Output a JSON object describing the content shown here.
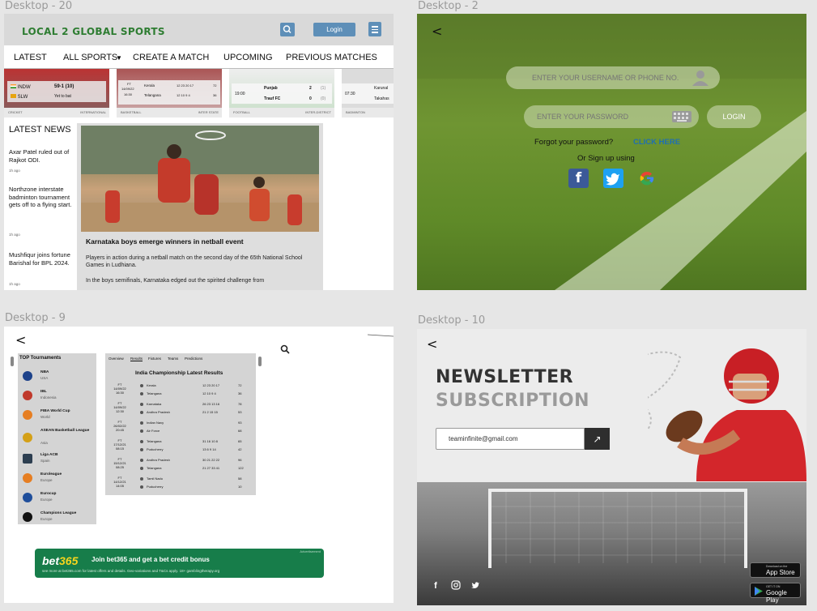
{
  "frames": {
    "desktop20": "Desktop - 20",
    "desktop2": "Desktop - 2",
    "desktop9": "Desktop - 9",
    "desktop10": "Desktop - 10"
  },
  "home": {
    "logo": "LOCAL 2 GLOBAL SPORTS",
    "login_label": "Login",
    "nav": [
      "LATEST",
      "ALL SPORTS",
      "CREATE A MATCH",
      "UPCOMING",
      "PREVIOUS MATCHES"
    ],
    "score_cards": [
      {
        "sport": "CRICKET",
        "level": "INTERNATIONAL",
        "team1": "INDW",
        "score1": "59-1 (10)",
        "team2": "SLW",
        "score2": "Yet to bat"
      },
      {
        "sport": "BASKETBALL",
        "level": "INTER STATE",
        "status": "FT",
        "date": "14/09/22",
        "time": "16:30",
        "team1": "Kerala",
        "q1": "12  23  20  17",
        "t1": "72",
        "team2": "Telangana",
        "q2": "12  10  9  4",
        "t2": "36"
      },
      {
        "sport": "FOOTBALL",
        "level": "INTER-DISTRICT",
        "time": "19:00",
        "team1": "Punjab",
        "score1": "2",
        "pen1": "(1)",
        "team2": "Trauf FC",
        "score2": "0",
        "pen2": "(0)"
      },
      {
        "sport": "BADMINTON",
        "time": "07:30",
        "team1": "Karunal",
        "team2": "Takahas"
      }
    ],
    "latest_news_heading": "LATEST NEWS",
    "news": [
      {
        "text": "Axar Patel ruled out of Rajkot ODI.",
        "ago": "1h ago"
      },
      {
        "text": "Northzone interstate badminton tournament gets off to a flying start.",
        "ago": "1h ago"
      },
      {
        "text": "Mushfiqur joins fortune Barishal for BPL 2024.",
        "ago": "1h ago"
      }
    ],
    "feature": {
      "title": "Karnataka boys emerge winners in netball event",
      "p1": "Players in action during a netball match on the second day of the 65th National School Games in Ludhiana.",
      "p2": "In the boys semifinals, Karnataka edged out the spirited challenge from"
    }
  },
  "login": {
    "back": "<",
    "username_placeholder": "ENTER YOUR USERNAME OR PHONE NO.",
    "password_placeholder": "ENTER YOUR PASSWORD",
    "login_label": "LOGIN",
    "forgot": "Forgot your password?",
    "click_here": "CLICK HERE",
    "or_signup": "Or Sign up using"
  },
  "tournaments": {
    "back": "<",
    "sidebar_heading": "TOP Tournaments",
    "items": [
      {
        "name": "NBA",
        "country": "USA",
        "color": "#1d428a"
      },
      {
        "name": "IBL",
        "country": "Indonesia",
        "color": "#c0392b"
      },
      {
        "name": "FIBA World Cup",
        "country": "World",
        "color": "#e67e22"
      },
      {
        "name": "ASEAN Basketball League",
        "country": "Asia",
        "color": "#d4a017"
      },
      {
        "name": "Liga ACB",
        "country": "Spain",
        "color": "#2c3e50"
      },
      {
        "name": "Euroleague",
        "country": "Europe",
        "color": "#e67e22"
      },
      {
        "name": "Eurocup",
        "country": "Europe",
        "color": "#1f4e9b"
      },
      {
        "name": "Champions League",
        "country": "Europe",
        "color": "#111"
      }
    ],
    "tabs": [
      "Overview",
      "Results",
      "Fixtures",
      "Teams",
      "Predictions"
    ],
    "results_heading": "India Championship Latest Results",
    "results": [
      {
        "status": "FT",
        "date": "14/09/22",
        "time": "16:30",
        "team1": "Kerala",
        "q1": "12  23  20  17",
        "t1": "72",
        "team2": "Telangana",
        "q2": "12  10  9  4",
        "t2": "36"
      },
      {
        "status": "FT",
        "date": "14/09/22",
        "time": "12:30",
        "team1": "Karnataka",
        "q1": "26  23  13  16",
        "t1": "78",
        "team2": "Andhra Pradesh",
        "q2": "21  2  15  15",
        "t2": "53"
      },
      {
        "status": "FT",
        "date": "26/02/22",
        "time": "20:45",
        "team1": "Indian Navy",
        "q1": "",
        "t1": "93",
        "team2": "Air Force",
        "q2": "",
        "t2": "68"
      },
      {
        "status": "FT",
        "date": "17/12/21",
        "time": "08:15",
        "team1": "Telangana",
        "q1": "31  16  10  8",
        "t1": "65",
        "team2": "Puducherry",
        "q2": "13  6  9  14",
        "t2": "42"
      },
      {
        "status": "FT",
        "date": "15/12/21",
        "time": "08:25",
        "team1": "Andhra Pradesh",
        "q1": "30  21  22  22",
        "t1": "96",
        "team2": "Telangana",
        "q2": "21  27  33  41",
        "t2": "122"
      },
      {
        "status": "FT",
        "date": "14/12/21",
        "time": "14:05",
        "team1": "Tamil Nadu",
        "q1": "",
        "t1": "58",
        "team2": "Puducherry",
        "q2": "",
        "t2": "10"
      }
    ],
    "ad": {
      "logo": "bet",
      "logo_num": "365",
      "headline": "Join bet365 and get a bet credit bonus",
      "fine": "see more at bet365.com for latest offers and details. Geo-variations and T&Cs apply. 18+ gamblingtherapy.org",
      "tag": "Advertisement"
    }
  },
  "newsletter": {
    "back": "<",
    "title1": "NEWSLETTER",
    "title2": "SUBSCRIPTION",
    "email_value": "teaminfinite@gmail.com",
    "submit": "↗",
    "appstore_small": "Download on the",
    "appstore": "App Store",
    "gplay_small": "GET IT ON",
    "gplay": "Google Play"
  }
}
